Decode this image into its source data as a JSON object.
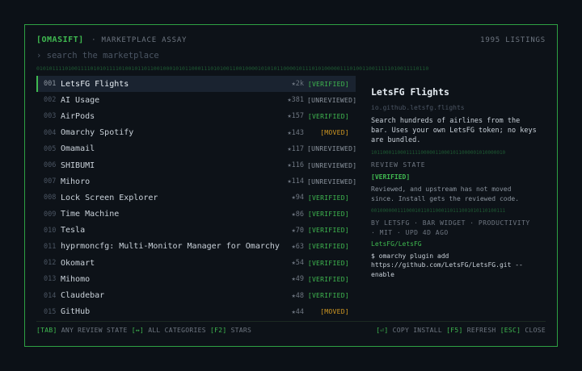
{
  "header": {
    "brand": "[OMASIFT]",
    "subtitle": "· MARKETPLACE ASSAY",
    "listings": "1995 LISTINGS",
    "search_placeholder": "› search the marketplace"
  },
  "binary_top": "0101011110100111101010111101001011011001000101011000111010100110010000101010110000101110101000001110100110011111010011110110",
  "items": [
    {
      "num": "001",
      "name": "LetsFG Flights",
      "stars": "★2k",
      "badge": "[VERIFIED]",
      "state": "verified",
      "selected": true
    },
    {
      "num": "002",
      "name": "AI Usage",
      "stars": "★381",
      "badge": "[UNREVIEWED]",
      "state": "unreviewed"
    },
    {
      "num": "003",
      "name": "AirPods",
      "stars": "★157",
      "badge": "[VERIFIED]",
      "state": "verified"
    },
    {
      "num": "004",
      "name": "Omarchy Spotify",
      "stars": "★143",
      "badge": "[MOVED]",
      "state": "moved"
    },
    {
      "num": "005",
      "name": "Omamail",
      "stars": "★117",
      "badge": "[UNREVIEWED]",
      "state": "unreviewed"
    },
    {
      "num": "006",
      "name": "SHIBUMI",
      "stars": "★116",
      "badge": "[UNREVIEWED]",
      "state": "unreviewed"
    },
    {
      "num": "007",
      "name": "Mihoro",
      "stars": "★114",
      "badge": "[UNREVIEWED]",
      "state": "unreviewed"
    },
    {
      "num": "008",
      "name": "Lock Screen Explorer",
      "stars": "★94",
      "badge": "[VERIFIED]",
      "state": "verified"
    },
    {
      "num": "009",
      "name": "Time Machine",
      "stars": "★86",
      "badge": "[VERIFIED]",
      "state": "verified"
    },
    {
      "num": "010",
      "name": "Tesla",
      "stars": "★70",
      "badge": "[VERIFIED]",
      "state": "verified"
    },
    {
      "num": "011",
      "name": "hyprmoncfg: Multi-Monitor Manager for Omarchy",
      "stars": "★63",
      "badge": "[VERIFIED]",
      "state": "verified"
    },
    {
      "num": "012",
      "name": "Okomart",
      "stars": "★54",
      "badge": "[VERIFIED]",
      "state": "verified"
    },
    {
      "num": "013",
      "name": "Mihomo",
      "stars": "★49",
      "badge": "[VERIFIED]",
      "state": "verified"
    },
    {
      "num": "014",
      "name": "Claudebar",
      "stars": "★48",
      "badge": "[VERIFIED]",
      "state": "verified"
    },
    {
      "num": "015",
      "name": "GitHub",
      "stars": "★44",
      "badge": "[MOVED]",
      "state": "moved"
    }
  ],
  "detail": {
    "title": "LetsFG Flights",
    "id": "io.github.letsfg.flights",
    "description": "Search hundreds of airlines from the bar. Uses your own LetsFG token; no keys are bundled.",
    "binary1": "1011000110001111100000110001011000001010000010",
    "review_label": "REVIEW STATE",
    "review_state": "[VERIFIED]",
    "review_note": "Reviewed, and upstream has not moved since. Install gets the reviewed code.",
    "binary2": "0010000001110001011011000110111001010110100111",
    "meta": "BY LETSFG  ·  BAR WIDGET  ·  PRODUCTIVITY  ·  MIT  ·  UPD 4D AGO",
    "link": "LetsFG/LetsFG",
    "command": "$ omarchy plugin add https://github.com/LetsFG/LetsFG.git --enable"
  },
  "footer": {
    "tab_key": "[TAB]",
    "tab_label": "ANY REVIEW STATE",
    "arrows_key": "[↔]",
    "arrows_label": "ALL CATEGORIES",
    "f2_key": "[F2]",
    "f2_label": "STARS",
    "enter_key": "[⏎]",
    "enter_label": "COPY INSTALL",
    "f5_key": "[F5]",
    "f5_label": "REFRESH",
    "esc_key": "[ESC]",
    "esc_label": "CLOSE"
  }
}
